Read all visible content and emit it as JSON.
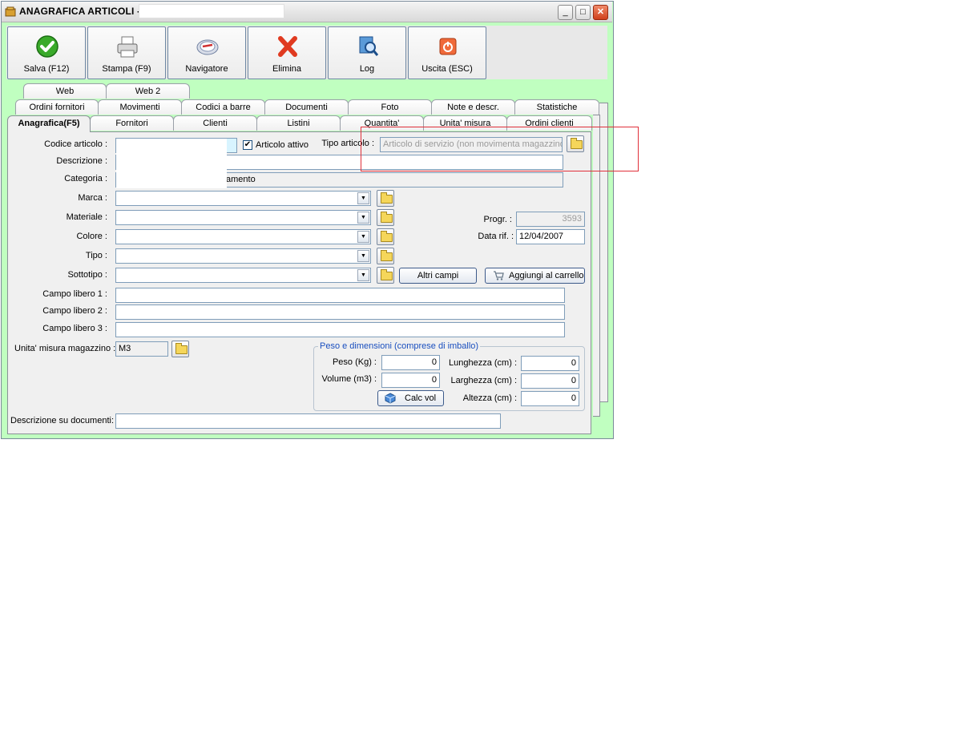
{
  "window": {
    "title": "ANAGRAFICA ARTICOLI -",
    "title_field": "",
    "controls": {
      "minimize": "_",
      "maximize": "□",
      "close": "✕"
    }
  },
  "toolbar": {
    "buttons": [
      {
        "label": "Salva (F12)",
        "icon": "check-icon"
      },
      {
        "label": "Stampa (F9)",
        "icon": "printer-icon"
      },
      {
        "label": "Navigatore",
        "icon": "compass-icon"
      },
      {
        "label": "Elimina",
        "icon": "delete-x-icon"
      },
      {
        "label": "Log",
        "icon": "log-search-icon"
      },
      {
        "label": "Uscita (ESC)",
        "icon": "power-icon"
      }
    ]
  },
  "tabs": {
    "row1": [
      "Web",
      "Web 2"
    ],
    "row2": [
      "Ordini fornitori",
      "Movimenti",
      "Codici a barre",
      "Documenti",
      "Foto",
      "Note e descr.",
      "Statistiche"
    ],
    "row3": [
      "Anagrafica(F5)",
      "Fornitori",
      "Clienti",
      "Listini",
      "Quantita'",
      "Unita' misura",
      "Ordini clienti"
    ],
    "active": "Anagrafica(F5)"
  },
  "form": {
    "codice_label": "Codice articolo :",
    "codice_value": "",
    "attivo_label": "Articolo attivo",
    "attivo_checked": "✔",
    "tipo_articolo_label": "Tipo articolo :",
    "tipo_articolo_value": "Articolo di servizio (non movimenta magazzino)",
    "descrizione_label": "Descrizione :",
    "descrizione_value": "",
    "categoria_label": "Categoria :",
    "categoria_value": "amento",
    "marca_label": "Marca :",
    "materiale_label": "Materiale :",
    "colore_label": "Colore :",
    "tipo_label": "Tipo :",
    "sottotipo_label": "Sottotipo :",
    "progr_label": "Progr. :",
    "progr_value": "3593",
    "data_rif_label": "Data rif. :",
    "data_rif_value": "12/04/2007",
    "altri_campi_label": "Altri campi",
    "aggiungi_carrello_label": "Aggiungi al carrello",
    "campo_libero_1_label": "Campo libero 1 :",
    "campo_libero_2_label": "Campo libero 2 :",
    "campo_libero_3_label": "Campo libero 3 :",
    "unita_misura_label": "Unita' misura magazzino :",
    "unita_misura_value": "M3",
    "descrizione_documenti_label": "Descrizione su documenti:",
    "descrizione_documenti_value": ""
  },
  "peso_dimensioni": {
    "title": "Peso e dimensioni (comprese di imballo)",
    "peso_label": "Peso (Kg) :",
    "peso_value": "0",
    "volume_label": "Volume (m3) :",
    "volume_value": "0",
    "lunghezza_label": "Lunghezza (cm) :",
    "lunghezza_value": "0",
    "larghezza_label": "Larghezza (cm) :",
    "larghezza_value": "0",
    "altezza_label": "Altezza (cm) :",
    "altezza_value": "0",
    "calc_vol_label": "Calc vol"
  },
  "colors": {
    "window_bg": "#c0ffc0",
    "panel_bg": "#f0f0f0",
    "highlight_box": "#e0303a",
    "group_title": "#1a4fbf"
  }
}
